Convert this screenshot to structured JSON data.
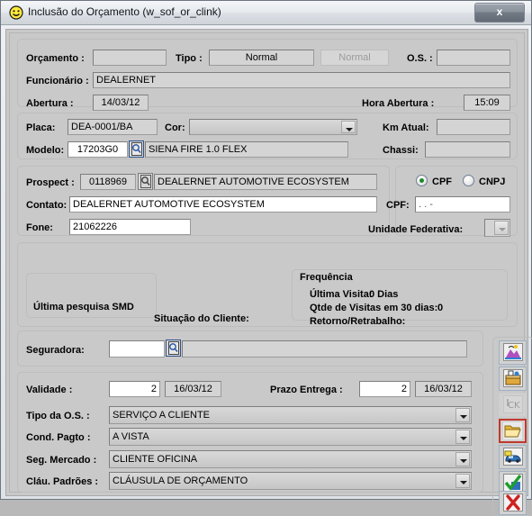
{
  "window": {
    "title": "Inclusão do Orçamento (w_sof_or_clink)",
    "icon": "smiley-face-icon",
    "close_label": "x"
  },
  "section_orcamento": {
    "orcamento_label": "Orçamento :",
    "orcamento_value": "",
    "tipo_label": "Tipo :",
    "tipo_value": "Normal",
    "tipo_button_label": "Normal",
    "os_label": "O.S. :",
    "os_value": "",
    "funcionario_label": "Funcionário :",
    "funcionario_value": "DEALERNET",
    "abertura_label": "Abertura :",
    "abertura_value": "14/03/12",
    "hora_abertura_label": "Hora Abertura :",
    "hora_abertura_value": "15:09"
  },
  "section_veiculo": {
    "placa_label": "Placa:",
    "placa_value": "DEA-0001/BA",
    "cor_label": "Cor:",
    "cor_value": "",
    "km_atual_label": "Km Atual:",
    "km_atual_value": "",
    "modelo_label": "Modelo:",
    "modelo_code": "17203G0",
    "modelo_desc": "SIENA FIRE 1.0 FLEX",
    "chassi_label": "Chassi:",
    "chassi_value": ""
  },
  "section_cliente": {
    "prospect_label": "Prospect :",
    "prospect_code": "0118969",
    "prospect_name": "DEALERNET AUTOMOTIVE ECOSYSTEM",
    "contato_label": "Contato:",
    "contato_value": "DEALERNET AUTOMOTIVE ECOSYSTEM",
    "fone_label": "Fone:",
    "fone_value": "21062226",
    "cpf_radio_label": "CPF",
    "cnpj_radio_label": "CNPJ",
    "selected_doc_type": "CPF",
    "cpf_label": "CPF:",
    "cpf_value": ".    .    -",
    "uf_label": "Unidade Federativa:",
    "uf_value": ""
  },
  "section_pesquisa": {
    "ultima_pesquisa_label": "Última pesquisa SMD",
    "situacao_cliente_label": "Situação do Cliente:",
    "frequencia_caption": "Frequência",
    "ultima_visita_label": "Última Visita:",
    "ultima_visita_value": "0 Dias",
    "qtde_visitas_label": "Qtde de Visitas em 30 dias:",
    "qtde_visitas_value": "0",
    "retorno_label": "Retorno/Retrabalho:",
    "retorno_value": ""
  },
  "section_seguradora": {
    "seguradora_label": "Seguradora:",
    "seguradora_code": "",
    "seguradora_desc": ""
  },
  "section_prazos": {
    "validade_label": "Validade :",
    "validade_days": "2",
    "validade_date": "16/03/12",
    "prazo_entrega_label": "Prazo Entrega :",
    "prazo_entrega_days": "2",
    "prazo_entrega_date": "16/03/12"
  },
  "section_os": {
    "tipo_os_label": "Tipo da O.S. :",
    "tipo_os_value": "SERVIÇO A CLIENTE",
    "cond_pagto_label": "Cond. Pagto :",
    "cond_pagto_value": "A VISTA",
    "seg_mercado_label": "Seg. Mercado :",
    "seg_mercado_value": "CLIENTE OFICINA",
    "clau_padroes_label": "Cláu. Padrões :",
    "clau_padroes_value": "CLÁUSULA DE ORÇAMENTO"
  },
  "toolbar": {
    "buttons": [
      {
        "name": "paint-palette-icon",
        "state": "enabled"
      },
      {
        "name": "open-drawer-icon",
        "state": "enabled"
      },
      {
        "name": "ok-text-icon",
        "state": "disabled"
      },
      {
        "name": "open-folder-icon",
        "state": "selected"
      },
      {
        "name": "car-icon",
        "state": "enabled"
      },
      {
        "name": "green-check-icon",
        "state": "enabled"
      },
      {
        "name": "red-x-icon",
        "state": "enabled"
      }
    ]
  },
  "colors": {
    "window_bg": "#c9c9c9",
    "accent_selected": "#c0392b",
    "radio_dot": "#1f8a2a"
  }
}
